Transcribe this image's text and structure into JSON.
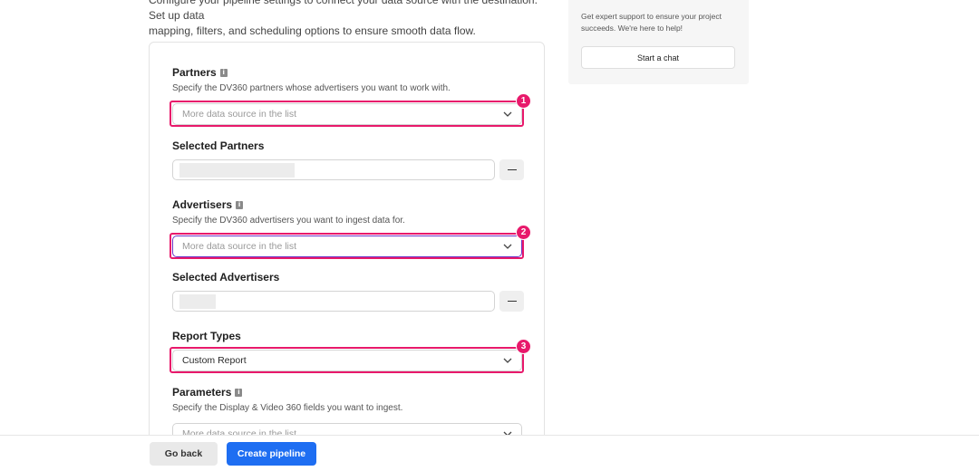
{
  "intro": {
    "line1": "Configure your pipeline settings to connect your data source with the destination. Set up data",
    "line2": "mapping, filters, and scheduling options to ensure smooth data flow."
  },
  "form": {
    "partners": {
      "label": "Partners",
      "description": "Specify the DV360 partners whose advertisers you want to work with.",
      "placeholder": "More data source in the list"
    },
    "selected_partners": {
      "label": "Selected Partners"
    },
    "advertisers": {
      "label": "Advertisers",
      "description": "Specify the DV360 advertisers you want to ingest data for.",
      "placeholder": "More data source in the list"
    },
    "selected_advertisers": {
      "label": "Selected Advertisers"
    },
    "report_types": {
      "label": "Report Types",
      "value": "Custom Report"
    },
    "parameters": {
      "label": "Parameters",
      "description": "Specify the Display & Video 360 fields you want to ingest.",
      "placeholder": "More data source in the list"
    }
  },
  "annotations": [
    "1",
    "2",
    "3"
  ],
  "side_panel": {
    "text": "Get expert support to ensure your project succeeds. We're here to help!",
    "button": "Start a chat"
  },
  "footer": {
    "back": "Go back",
    "create": "Create pipeline"
  },
  "colors": {
    "highlight": "#e8196b",
    "primary": "#1e6ef2"
  }
}
